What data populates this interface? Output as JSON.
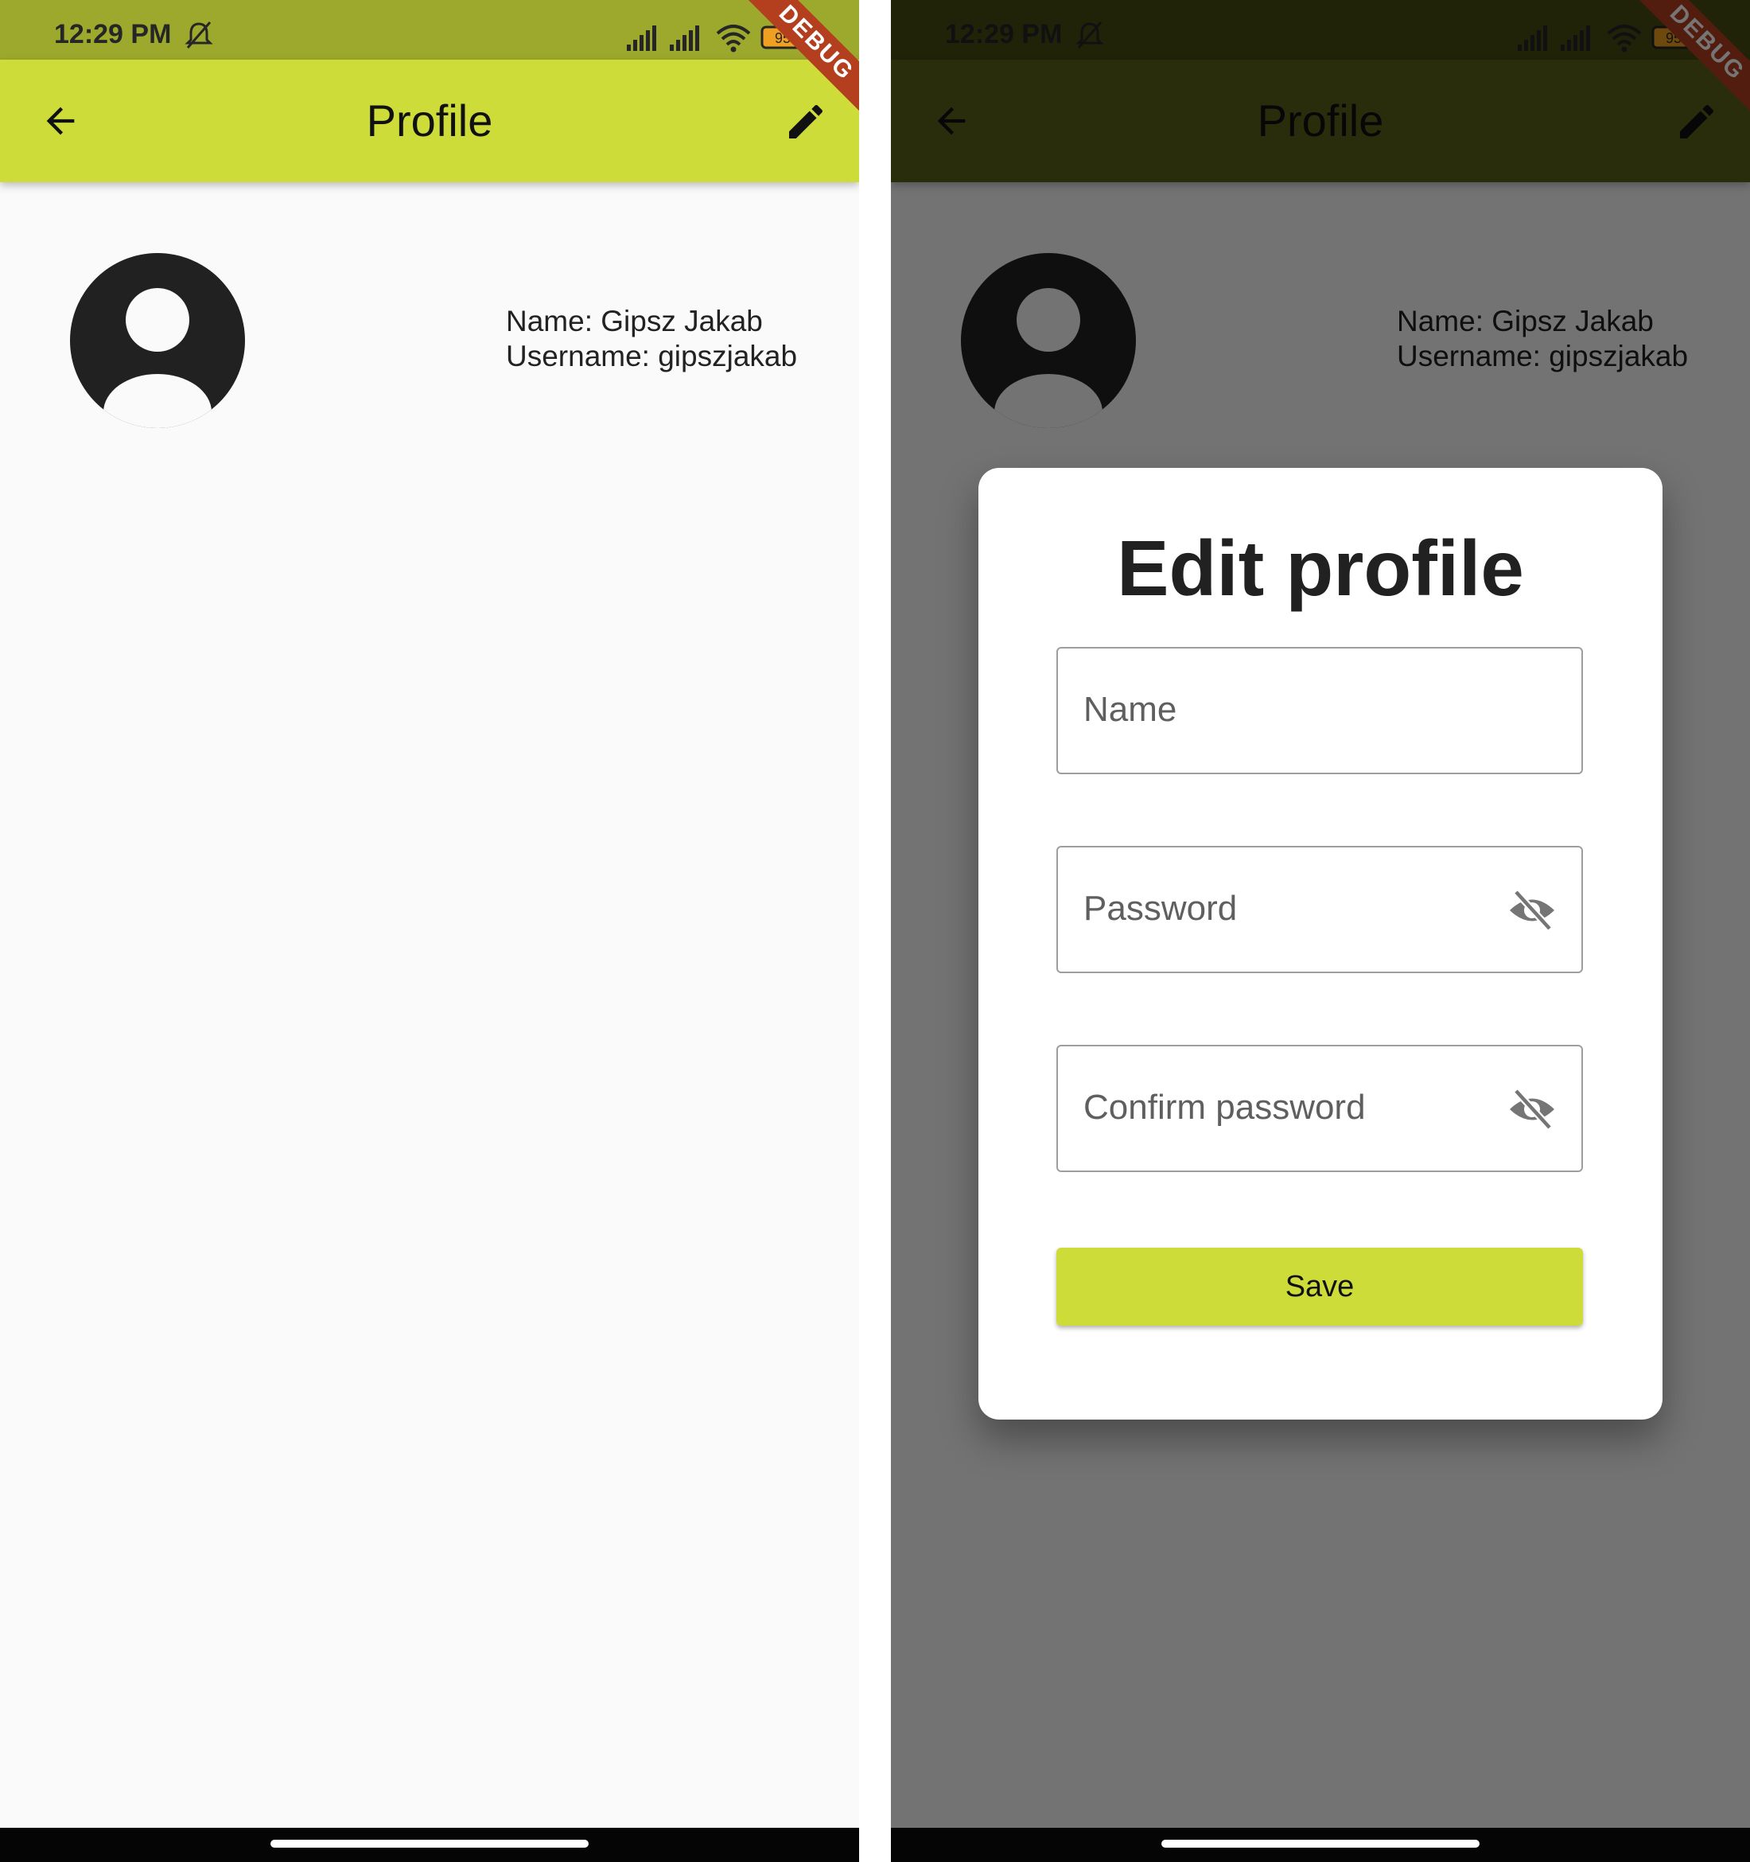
{
  "status_bar": {
    "time": "12:29 PM",
    "battery": "95"
  },
  "app_bar": {
    "title": "Profile",
    "debug_banner": "DEBUG"
  },
  "profile": {
    "name_line": "Name: Gipsz Jakab",
    "username_line": "Username: gipszjakab"
  },
  "dialog": {
    "title": "Edit profile",
    "fields": [
      {
        "label": "Name"
      },
      {
        "label": "Password"
      },
      {
        "label": "Confirm password"
      }
    ],
    "save_label": "Save"
  },
  "colors": {
    "app_bar": "#cddc39",
    "status_bar": "#9da92c",
    "app_bar_dimmed": "#5c6318",
    "status_bar_dimmed": "#474c13",
    "scrim": "#737373",
    "debug_ribbon": "#b33f1f"
  }
}
